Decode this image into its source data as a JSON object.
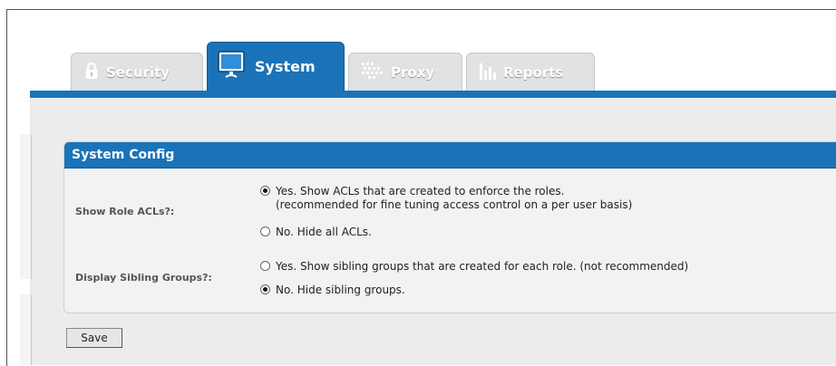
{
  "tabs": [
    {
      "label": "Security",
      "icon": "lock-icon",
      "active": false
    },
    {
      "label": "System",
      "icon": "monitor-icon",
      "active": true
    },
    {
      "label": "Proxy",
      "icon": "proxy-grid-icon",
      "active": false
    },
    {
      "label": "Reports",
      "icon": "bar-chart-icon",
      "active": false
    }
  ],
  "panel": {
    "title": "System Config",
    "show_role_acls": {
      "label": "Show Role ACLs?:",
      "option_yes_line1": "Yes. Show ACLs that are created to enforce the roles.",
      "option_yes_line2": "(recommended for fine tuning access control on a per user basis)",
      "option_no": "No. Hide all ACLs.",
      "selected": "yes"
    },
    "display_sibling_groups": {
      "label": "Display Sibling Groups?:",
      "option_yes": "Yes. Show sibling groups that are created for each role. (not recommended)",
      "option_no": "No. Hide sibling groups.",
      "selected": "no"
    }
  },
  "save_label": "Save",
  "colors": {
    "accent": "#1a73b8",
    "tab_inactive": "#e2e2e2",
    "panel_bg": "#f2f2f2"
  }
}
